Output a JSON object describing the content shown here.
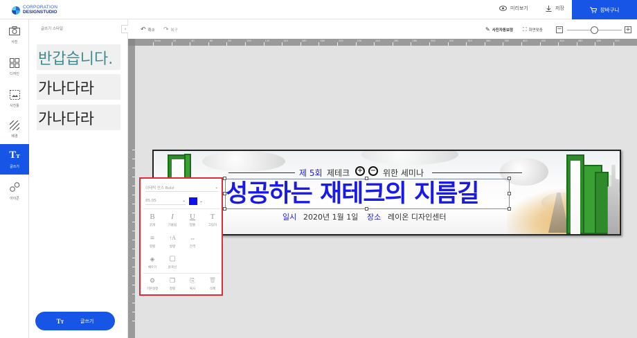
{
  "topbar": {
    "logo_line1": "CORPORATION",
    "logo_line2": "DESIGNSTUDIO",
    "preview_label": "미리보기",
    "save_label": "저장",
    "cart_label": "장바구니",
    "cart_color": "#1755e6"
  },
  "rail": {
    "items": [
      {
        "label": "사진",
        "icon": "camera-icon"
      },
      {
        "label": "디자인",
        "icon": "layout-icon"
      },
      {
        "label": "사진틀",
        "icon": "image-frame-icon"
      },
      {
        "label": "배경",
        "icon": "background-icon"
      },
      {
        "label": "글쓰기",
        "icon": "text-icon",
        "active": true
      },
      {
        "label": "아이콘",
        "icon": "shapes-icon"
      }
    ]
  },
  "panel": {
    "title": "글쓰기 스타일",
    "samples": [
      {
        "text": "반갑습니다.",
        "color": "#3f8a8e"
      },
      {
        "text": "가나다라",
        "color": "#222222"
      },
      {
        "text": "가나다라",
        "color": "#222222"
      }
    ],
    "write_button_icon": "Tт",
    "write_button_label": "글쓰기"
  },
  "editor": {
    "undo_label": "취소",
    "redo_label": "복구",
    "auto_correct_label": "사진자동보정",
    "fit_label": "화면맞춤",
    "zoom_level": 0.5
  },
  "ruler": {
    "h_marks": [
      "0mm",
      "20",
      "40",
      "60",
      "80",
      "100",
      "120",
      "140",
      "160",
      "180",
      "200",
      "220",
      "240",
      "260",
      "280",
      "300",
      "320",
      "340",
      "360",
      "380",
      "400",
      "420",
      "440",
      "460",
      "480",
      "500"
    ]
  },
  "banner": {
    "line1_prefix": "제 5회",
    "line1_rest": "제테크",
    "line1_suffix": "위한 세미나",
    "main_title": "성공하는 재테크의 지름길",
    "date_label": "일시",
    "date_value": "2020년 1월 1일",
    "place_label": "장소",
    "place_value": "레이온 디자인센터",
    "accent_color": "#1a1ae6"
  },
  "text_toolbar": {
    "font_name": "이태릭 산스 Bold",
    "font_size": "85.05",
    "color": "#1010ee",
    "row1": [
      {
        "glyph": "B",
        "label": "굵게"
      },
      {
        "glyph": "I",
        "label": "기울림"
      },
      {
        "glyph": "U",
        "label": "밑줄"
      },
      {
        "glyph": "T",
        "label": "그림자"
      }
    ],
    "row2": [
      {
        "glyph": "≡",
        "label": "정렬"
      },
      {
        "glyph": "↑A",
        "label": "방향"
      },
      {
        "glyph": "⇔",
        "label": "간격"
      }
    ],
    "row3": [
      {
        "glyph": "◈",
        "label": "채우기"
      },
      {
        "glyph": "▢",
        "label": "윤곽선"
      }
    ],
    "row4": [
      {
        "glyph": "⚙",
        "label": "기본설정"
      },
      {
        "glyph": "❐",
        "label": "정렬"
      },
      {
        "glyph": "⎘",
        "label": "복사"
      },
      {
        "glyph": "🗑",
        "label": "삭제"
      }
    ]
  }
}
